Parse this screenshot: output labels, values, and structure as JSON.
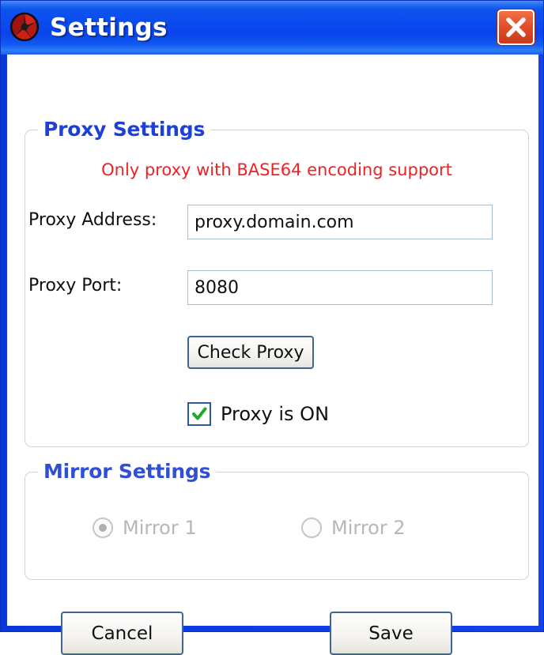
{
  "window": {
    "title": "Settings",
    "icon": "app-logo-icon",
    "close_icon": "close-icon",
    "accent_color": "#0b49ee",
    "close_color": "#e2502a"
  },
  "proxy_group": {
    "title": "Proxy Settings",
    "warning": "Only proxy with BASE64 encoding support",
    "warning_color": "#ee2222",
    "title_color": "#1c40d8",
    "address_label": "Proxy Address:",
    "address_value": "proxy.domain.com",
    "address_placeholder": "proxy.domain.com",
    "port_label": "Proxy Port:",
    "port_value": "8080",
    "port_placeholder": "8080",
    "check_button_label": "Check Proxy",
    "checkbox_label": "Proxy is ON",
    "checkbox_checked": true,
    "check_color": "#1eaa2a"
  },
  "mirror_group": {
    "title": "Mirror Settings",
    "enabled": false,
    "options": [
      {
        "label": "Mirror 1",
        "selected": true
      },
      {
        "label": "Mirror 2",
        "selected": false
      }
    ]
  },
  "footer": {
    "cancel_label": "Cancel",
    "save_label": "Save"
  }
}
